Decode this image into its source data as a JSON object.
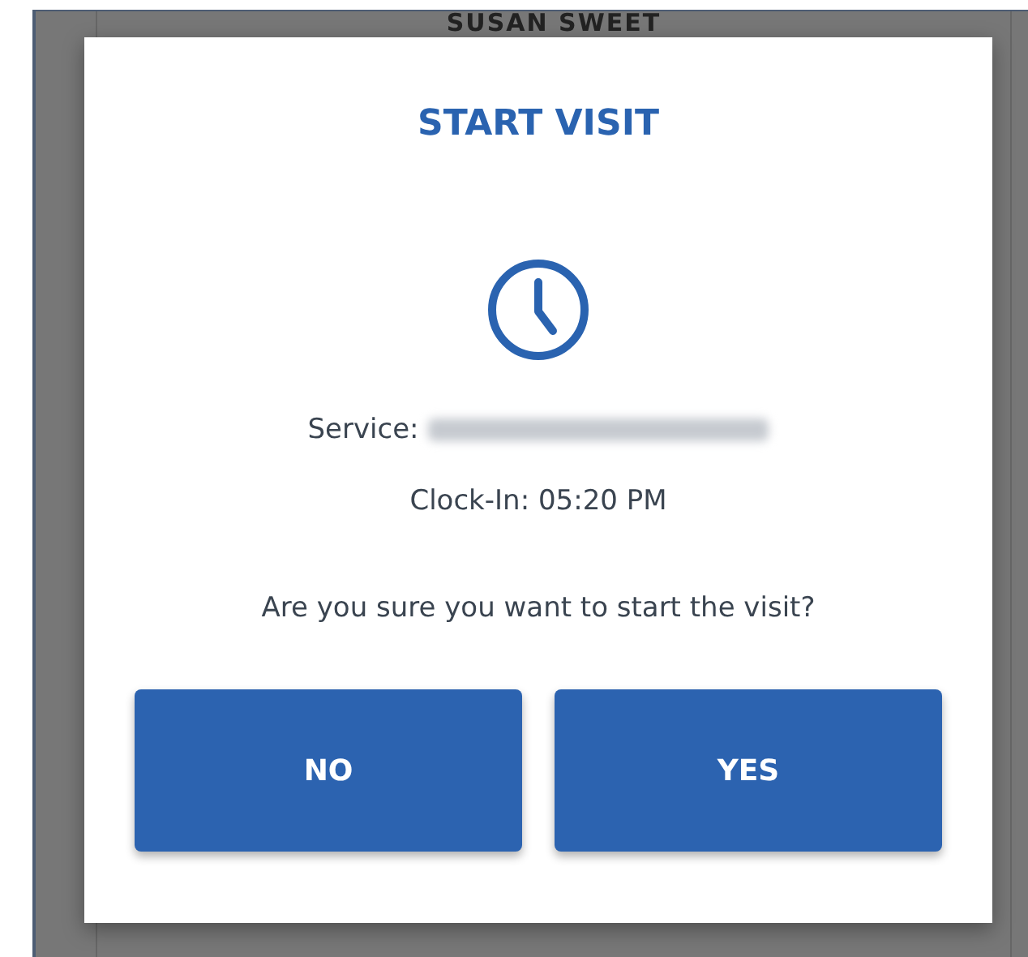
{
  "background": {
    "heading": "SUSAN SWEET"
  },
  "dialog": {
    "title": "START VISIT",
    "details": [
      {
        "kind": "redacted",
        "label": "Service:"
      },
      {
        "kind": "text",
        "label": "Clock-In: 05:20 PM"
      }
    ],
    "question": "Are you sure you want to start the visit?",
    "buttons": [
      {
        "label": "NO"
      },
      {
        "label": "YES"
      }
    ]
  }
}
